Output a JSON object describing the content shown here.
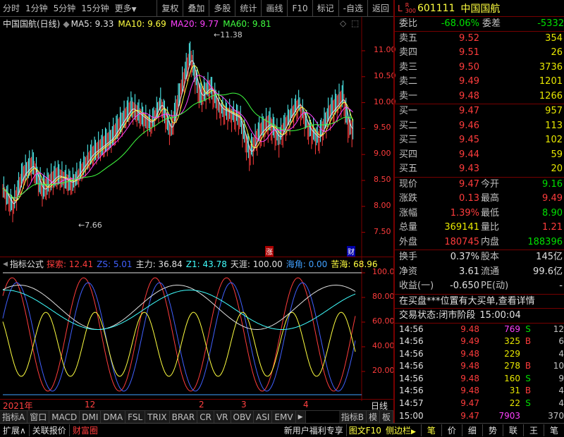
{
  "toolbar": {
    "items": [
      "分时",
      "1分钟",
      "5分钟",
      "15分钟",
      "更多"
    ],
    "buttons": [
      "复权",
      "叠加",
      "多股",
      "统计",
      "画线",
      "F10",
      "标记",
      "-自选",
      "返回"
    ]
  },
  "header": {
    "code": "601111",
    "name": "中国国航",
    "tag_l": "L",
    "tag_r": "R",
    "tag_num": "300"
  },
  "chart": {
    "title": "中国国航(日线)",
    "ma5": "MA5: 9.33",
    "ma10": "MA10: 9.69",
    "ma20": "MA20: 9.77",
    "ma60": "MA60: 9.81",
    "high_label": "11.38",
    "low_label": "7.66",
    "yticks": [
      "11.00",
      "10.50",
      "10.00",
      "9.50",
      "9.00",
      "8.50",
      "8.00",
      "7.50"
    ],
    "badge_zhang": "涨",
    "badge_cai": "财"
  },
  "indicator": {
    "name": "指标公式",
    "items": [
      {
        "k": "探索:",
        "v": "12.41",
        "c": "#ff3c3c"
      },
      {
        "k": "ZS:",
        "v": "5.01",
        "c": "#4060ff"
      },
      {
        "k": "主力:",
        "v": "36.84",
        "c": "#e0e0e0"
      },
      {
        "k": "Z1:",
        "v": "43.78",
        "c": "#40ffff"
      },
      {
        "k": "天涯:",
        "v": "100.00",
        "c": "#e0e0e0"
      },
      {
        "k": "海角:",
        "v": "0.00",
        "c": "#40a0ff"
      },
      {
        "k": "苦海:",
        "v": "68.96",
        "c": "#ffff40"
      }
    ],
    "yticks": [
      "100.0",
      "80.00",
      "60.00",
      "40.00",
      "20.00"
    ]
  },
  "timeaxis": {
    "labels": [
      "2021年",
      "12",
      "2",
      "3",
      "4"
    ],
    "right": "日线"
  },
  "tabs": [
    "指标A",
    "窗口",
    "MACD",
    "DMI",
    "DMA",
    "FSL",
    "TRIX",
    "BRAR",
    "CR",
    "VR",
    "OBV",
    "ASI",
    "EMV"
  ],
  "tabs_right": [
    "指标B",
    "模",
    "板"
  ],
  "bottom": {
    "left": [
      "扩展∧",
      "关联报价",
      "财富圈"
    ],
    "mid": "新用户福利专享",
    "right": [
      "图文F10",
      "侧边栏"
    ],
    "icons": [
      "笔",
      "价",
      "细",
      "势",
      "联",
      "王",
      "笔"
    ]
  },
  "quote": {
    "weibi_label": "委比",
    "weibi": "-68.06%",
    "weicha_label": "委差",
    "weicha": "-5332",
    "sells": [
      {
        "l": "卖五",
        "p": "9.52",
        "v": "354"
      },
      {
        "l": "卖四",
        "p": "9.51",
        "v": "26"
      },
      {
        "l": "卖三",
        "p": "9.50",
        "v": "3736"
      },
      {
        "l": "卖二",
        "p": "9.49",
        "v": "1201"
      },
      {
        "l": "卖一",
        "p": "9.48",
        "v": "1266"
      }
    ],
    "buys": [
      {
        "l": "买一",
        "p": "9.47",
        "v": "957"
      },
      {
        "l": "买二",
        "p": "9.46",
        "v": "113"
      },
      {
        "l": "买三",
        "p": "9.45",
        "v": "102"
      },
      {
        "l": "买四",
        "p": "9.44",
        "v": "59"
      },
      {
        "l": "买五",
        "p": "9.43",
        "v": "20"
      }
    ],
    "stats": [
      [
        {
          "l": "现价",
          "v": "9.47",
          "c": "red"
        },
        {
          "l": "今开",
          "v": "9.16",
          "c": "grn"
        }
      ],
      [
        {
          "l": "涨跌",
          "v": "0.13",
          "c": "red"
        },
        {
          "l": "最高",
          "v": "9.49",
          "c": "red"
        }
      ],
      [
        {
          "l": "涨幅",
          "v": "1.39%",
          "c": "red"
        },
        {
          "l": "最低",
          "v": "8.90",
          "c": "grn"
        }
      ],
      [
        {
          "l": "总量",
          "v": "369141",
          "c": "yel"
        },
        {
          "l": "量比",
          "v": "1.21",
          "c": "red"
        }
      ],
      [
        {
          "l": "外盘",
          "v": "180745",
          "c": "red"
        },
        {
          "l": "内盘",
          "v": "188396",
          "c": "grn"
        }
      ]
    ],
    "stats2": [
      [
        {
          "l": "换手",
          "v": "0.37%",
          "c": "wht"
        },
        {
          "l": "股本",
          "v": "145亿",
          "c": "wht"
        }
      ],
      [
        {
          "l": "净资",
          "v": "3.61",
          "c": "wht"
        },
        {
          "l": "流通",
          "v": "99.6亿",
          "c": "wht"
        }
      ],
      [
        {
          "l": "收益(一)",
          "v": "-0.650",
          "c": "wht"
        },
        {
          "l": "PE(动)",
          "v": "-",
          "c": "wht"
        }
      ]
    ],
    "notice": "在买盘***位置有大买单,查看详情",
    "status_label": "交易状态:",
    "status": "闭市阶段",
    "status_time": "15:00:04",
    "ticks": [
      {
        "t": "14:56",
        "p": "9.48",
        "v": "769",
        "f": "S",
        "n": "12",
        "vc": "mag",
        "fc": "grn"
      },
      {
        "t": "14:56",
        "p": "9.49",
        "v": "325",
        "f": "B",
        "n": "6",
        "vc": "yel",
        "fc": "red"
      },
      {
        "t": "14:56",
        "p": "9.48",
        "v": "229",
        "f": "",
        "n": "4",
        "vc": "yel",
        "fc": "grn"
      },
      {
        "t": "14:56",
        "p": "9.48",
        "v": "278",
        "f": "B",
        "n": "10",
        "vc": "yel",
        "fc": "red"
      },
      {
        "t": "14:56",
        "p": "9.48",
        "v": "160",
        "f": "S",
        "n": "9",
        "vc": "yel",
        "fc": "grn"
      },
      {
        "t": "14:56",
        "p": "9.48",
        "v": "31",
        "f": "B",
        "n": "4",
        "vc": "yel",
        "fc": "red"
      },
      {
        "t": "14:57",
        "p": "9.47",
        "v": "22",
        "f": "S",
        "n": "4",
        "vc": "yel",
        "fc": "grn"
      },
      {
        "t": "15:00",
        "p": "9.47",
        "v": "7903",
        "f": "",
        "n": "370",
        "vc": "mag",
        "fc": "grn"
      }
    ]
  }
}
